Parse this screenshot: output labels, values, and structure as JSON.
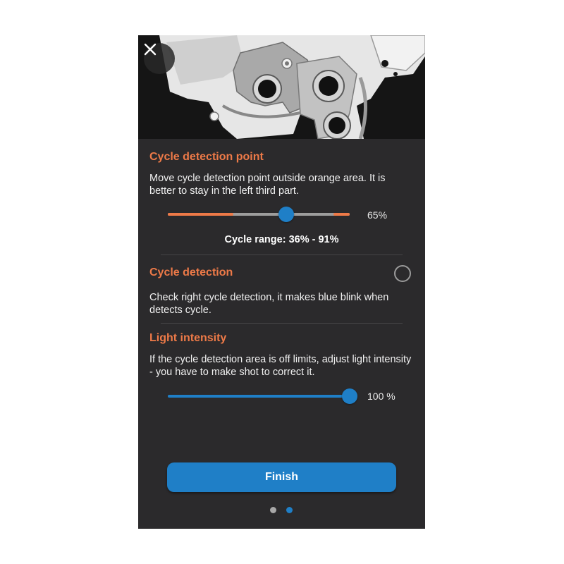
{
  "header": {
    "close_icon": "close-icon",
    "image": "gearbox-illustration"
  },
  "cycle_detection_point": {
    "title": "Cycle detection point",
    "description": "Move cycle detection point outside orange area. It is better to stay in the left third part.",
    "slider_value": 65,
    "slider_label": "65%",
    "range_start": 36,
    "range_end": 91,
    "range_label": "Cycle range: 36% - 91%"
  },
  "cycle_detection": {
    "title": "Cycle detection",
    "checked": false,
    "description": "Check right cycle detection, it makes blue blink when detects cycle."
  },
  "light_intensity": {
    "title": "Light intensity",
    "description": "If the cycle detection area is off limits, adjust light intensity - you have to make shot to correct it.",
    "slider_value": 100,
    "slider_label": "100 %"
  },
  "finish_button": {
    "label": "Finish"
  },
  "pager": {
    "page_count": 2,
    "current_page": 2
  },
  "colors": {
    "background": "#2b2a2c",
    "accent_orange": "#ee7a48",
    "accent_blue": "#1f7fc7",
    "track_gray": "#9d9d9d",
    "inactive_dot": "#a8a8a8"
  }
}
